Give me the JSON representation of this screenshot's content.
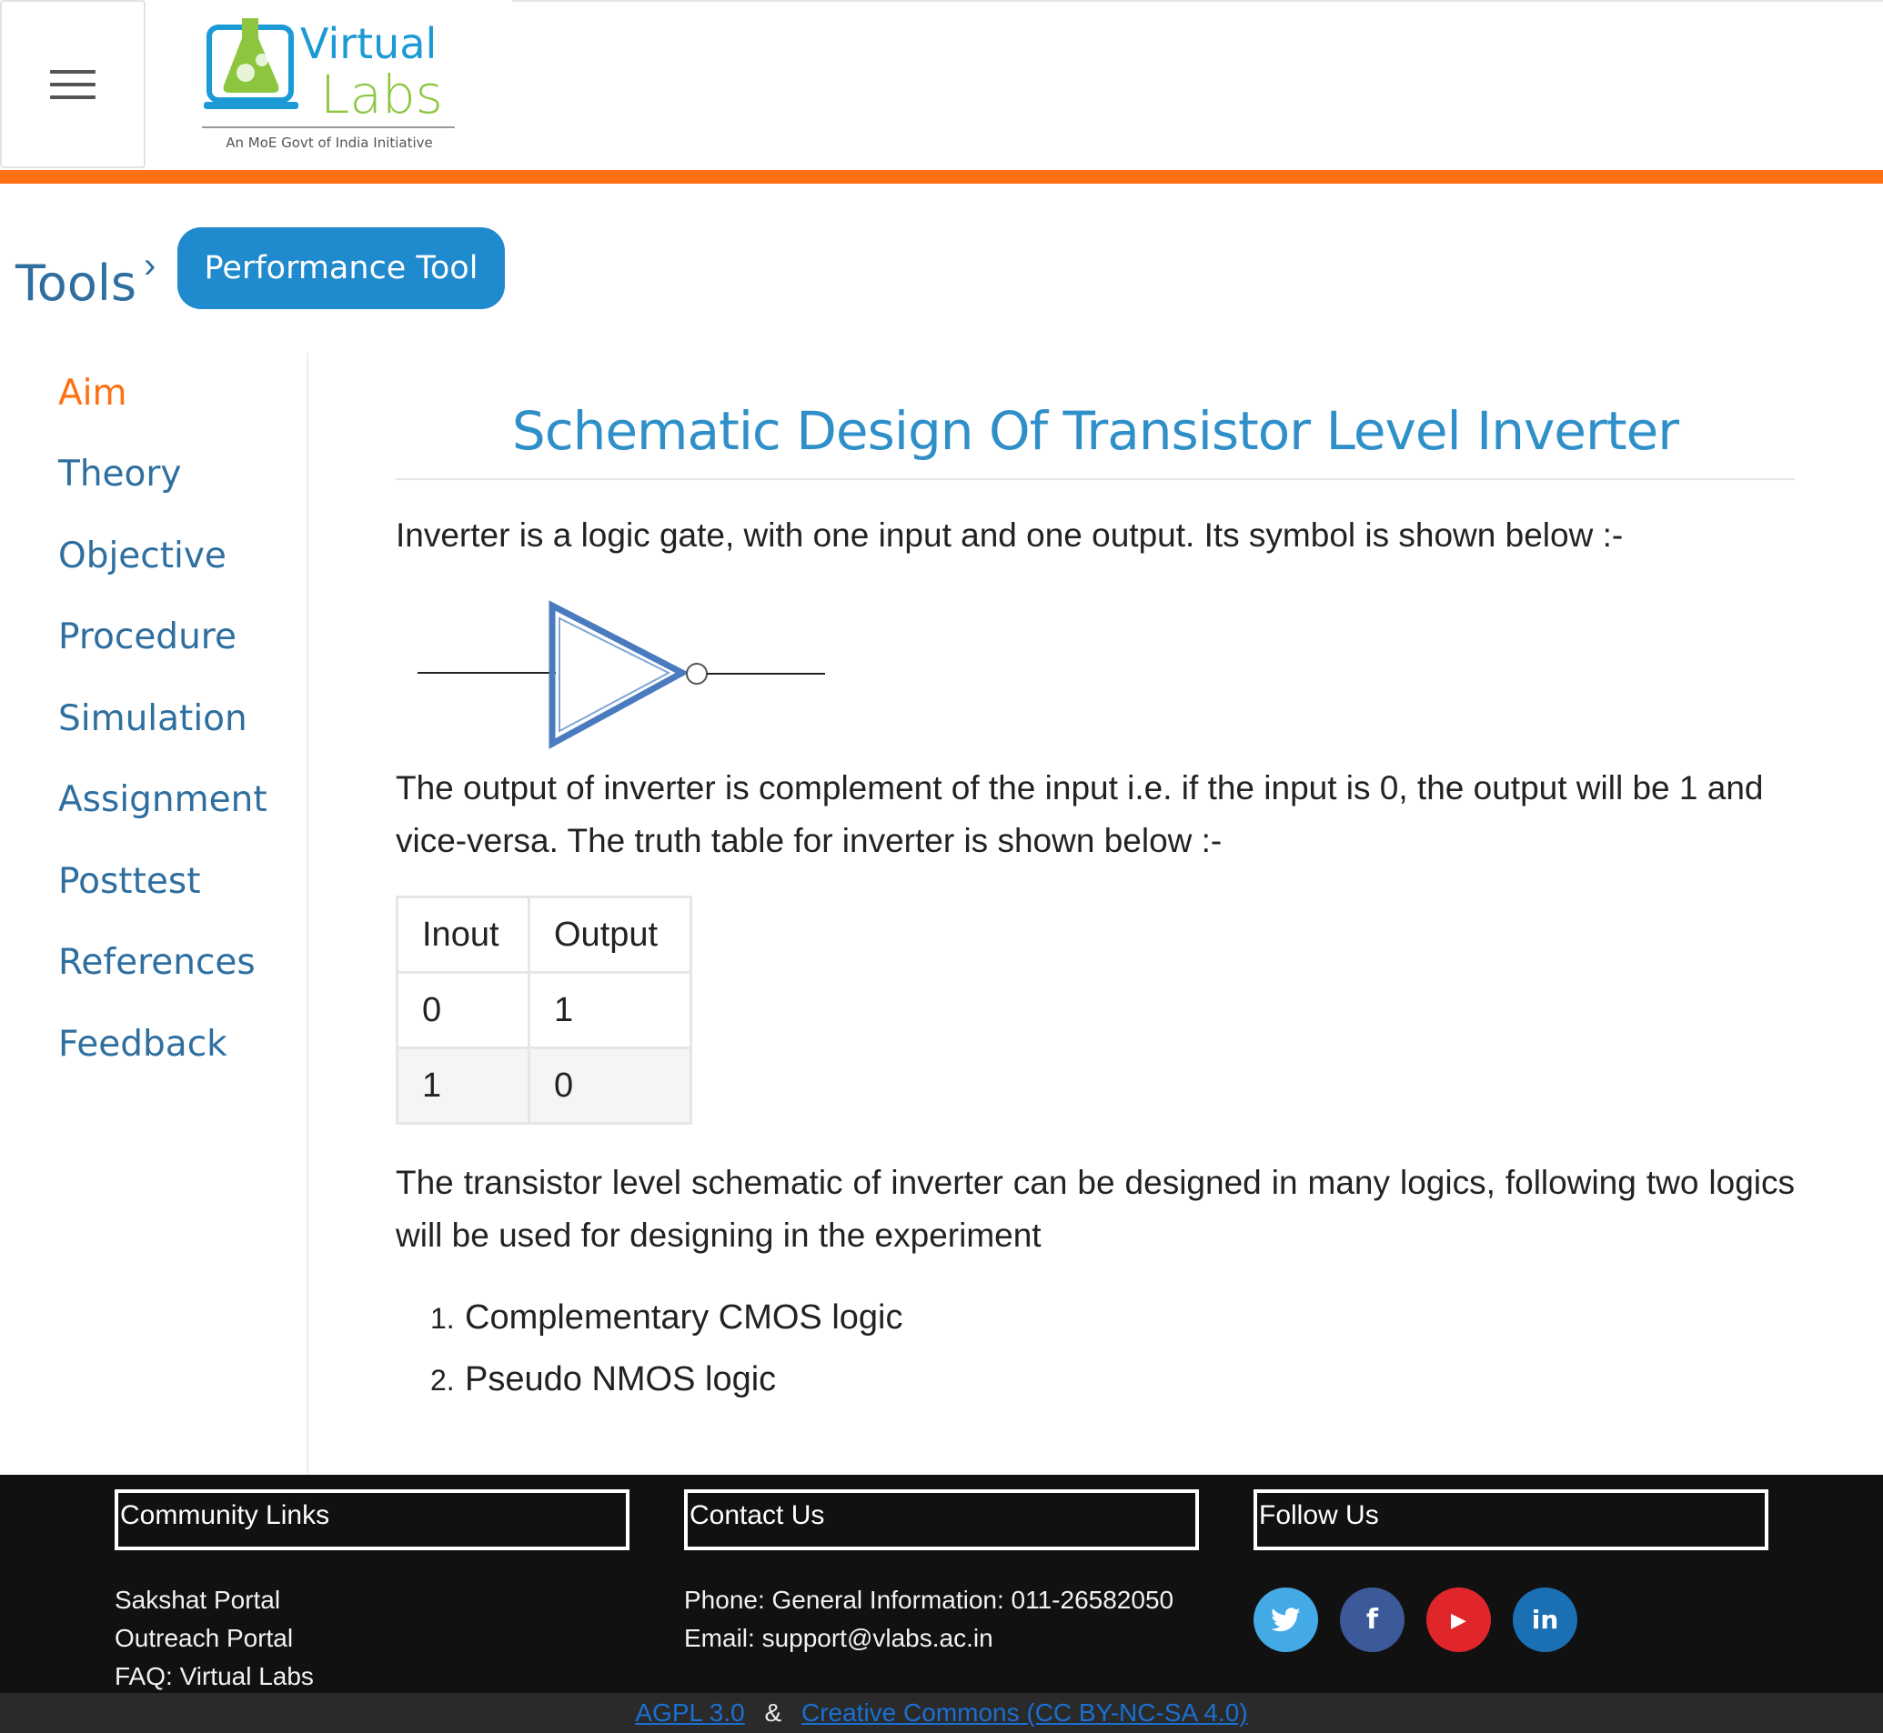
{
  "header": {
    "menu_icon": "hamburger-menu-icon",
    "logo": {
      "line1": "Virtual",
      "line2": "Labs",
      "tagline": "An MoE Govt of India Initiative"
    }
  },
  "breadcrumb": {
    "root": "Tools",
    "separator_icon": "chevron-right-icon",
    "current": "Performance Tool"
  },
  "sidebar": {
    "items": [
      {
        "label": "Aim",
        "active": true
      },
      {
        "label": "Theory",
        "active": false
      },
      {
        "label": "Objective",
        "active": false
      },
      {
        "label": "Procedure",
        "active": false
      },
      {
        "label": "Simulation",
        "active": false
      },
      {
        "label": "Assignment",
        "active": false
      },
      {
        "label": "Posttest",
        "active": false
      },
      {
        "label": "References",
        "active": false
      },
      {
        "label": "Feedback",
        "active": false
      }
    ]
  },
  "content": {
    "title": "Schematic Design Of Transistor Level Inverter",
    "para1": "Inverter is a logic gate, with one input and one output. Its symbol is shown below :-",
    "para2": "The output of inverter is complement of the input i.e. if the input is 0, the output will be 1 and vice-versa. The truth table for inverter is shown below :-",
    "table": {
      "headers": [
        "Inout",
        "Output"
      ],
      "rows": [
        [
          "0",
          "1"
        ],
        [
          "1",
          "0"
        ]
      ]
    },
    "para3": "The transistor level schematic of inverter can be designed in many logics, following two logics will be used for designing in the experiment",
    "list": [
      {
        "num": "1.",
        "text": "Complementary CMOS logic"
      },
      {
        "num": "2.",
        "text": "Pseudo NMOS logic"
      }
    ]
  },
  "footer": {
    "community": {
      "heading": "Community Links",
      "links": [
        "Sakshat Portal",
        "Outreach Portal",
        "FAQ: Virtual Labs"
      ]
    },
    "contact": {
      "heading": "Contact Us",
      "phone": "Phone: General Information: 011-26582050",
      "email": "Email: support@vlabs.ac.in"
    },
    "follow": {
      "heading": "Follow Us",
      "icons": [
        {
          "name": "twitter-icon",
          "glyph": "🐦",
          "color": "#43aae6"
        },
        {
          "name": "facebook-icon",
          "glyph": "f",
          "color": "#3c5a99"
        },
        {
          "name": "youtube-icon",
          "glyph": "▶",
          "color": "#e0262b"
        },
        {
          "name": "linkedin-icon",
          "glyph": "in",
          "color": "#1b6fb3"
        }
      ]
    },
    "license": {
      "link1": "AGPL 3.0",
      "sep": "&",
      "link2": "Creative Commons (CC BY-NC-SA 4.0)"
    }
  },
  "colors": {
    "accent_orange": "#ff6f14",
    "link_blue": "#2f6fa0",
    "button_blue": "#1f8acd",
    "title_blue": "#2f8fc8"
  }
}
